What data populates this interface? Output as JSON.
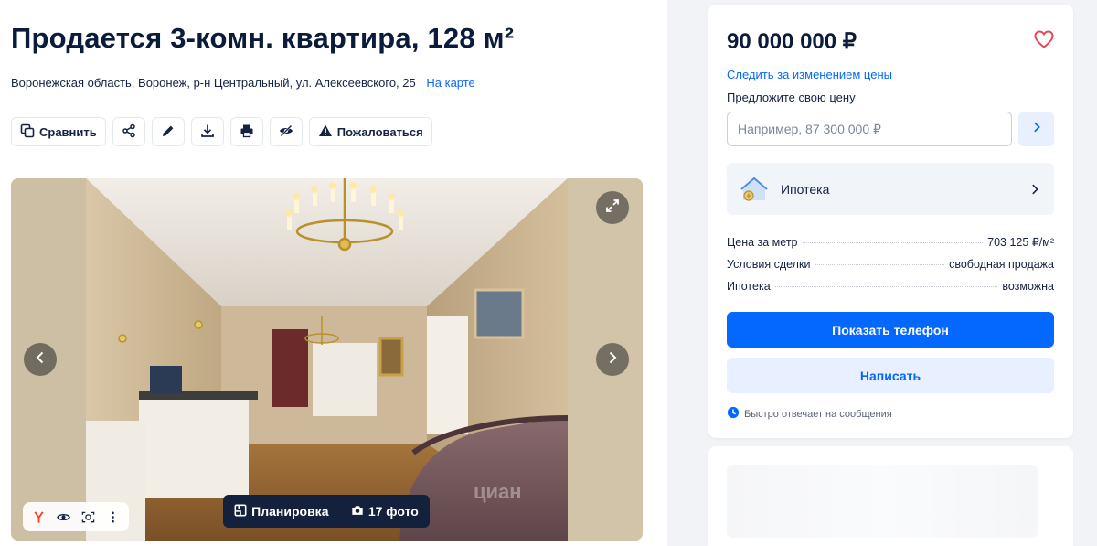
{
  "listing": {
    "title": "Продается 3-комн. квартира, 128 м²",
    "address": "Воронежская область, Воронеж, р-н Центральный, ул. Алексеевского, 25",
    "map_link": "На карте"
  },
  "toolbar": {
    "compare": "Сравнить",
    "complain": "Пожаловаться",
    "icons": [
      "compare-icon",
      "share-icon",
      "edit-icon",
      "download-icon",
      "print-icon",
      "hide-icon",
      "warning-icon"
    ]
  },
  "gallery": {
    "layout_label": "Планировка",
    "photos_label": "17 фото",
    "watermark": "циан"
  },
  "sidebar": {
    "price": "90 000 000 ₽",
    "follow_price": "Следить за изменением цены",
    "offer_label": "Предложите свою цену",
    "offer_placeholder": "Например, 87 300 000 ₽",
    "mortgage_label": "Ипотека",
    "facts": [
      {
        "label": "Цена за метр",
        "value": "703 125 ₽/м²"
      },
      {
        "label": "Условия сделки",
        "value": "свободная продажа"
      },
      {
        "label": "Ипотека",
        "value": "возможна"
      }
    ],
    "show_phone": "Показать телефон",
    "write": "Написать",
    "fast_reply": "Быстро отвечает на сообщения"
  },
  "colors": {
    "accent": "#0468ff",
    "accent_light": "#e8f0ff",
    "text": "#152242",
    "favorite": "#e8484f"
  }
}
